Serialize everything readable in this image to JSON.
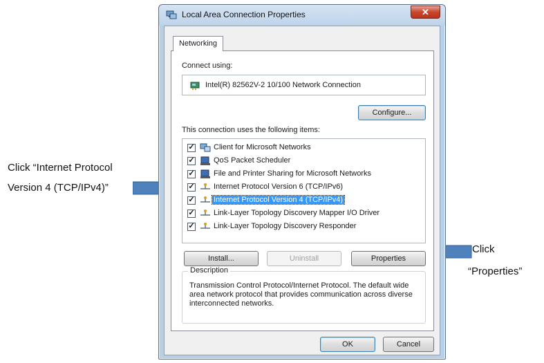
{
  "annotations": {
    "left_line1": "Click “Internet Protocol",
    "left_line2": "Version 4 (TCP/IPv4)”",
    "right_line1": "Click",
    "right_line2": "“Properties”"
  },
  "window": {
    "title": "Local Area Connection Properties",
    "close_glyph": "✕"
  },
  "tabs": [
    {
      "label": "Networking",
      "active": true
    }
  ],
  "connect_using": {
    "label": "Connect using:",
    "adapter": "Intel(R) 82562V-2 10/100 Network Connection",
    "icon": "network-adapter-icon"
  },
  "configure_label": "Configure...",
  "items_label": "This connection uses the following items:",
  "items": [
    {
      "label": "Client for Microsoft Networks",
      "checked": true,
      "icon": "client-network-icon"
    },
    {
      "label": "QoS Packet Scheduler",
      "checked": true,
      "icon": "service-icon"
    },
    {
      "label": "File and Printer Sharing for Microsoft Networks",
      "checked": true,
      "icon": "service-icon"
    },
    {
      "label": "Internet Protocol Version 6 (TCP/IPv6)",
      "checked": true,
      "icon": "protocol-icon"
    },
    {
      "label": "Internet Protocol Version 4 (TCP/IPv4)",
      "checked": true,
      "icon": "protocol-icon",
      "selected": true
    },
    {
      "label": "Link-Layer Topology Discovery Mapper I/O Driver",
      "checked": true,
      "icon": "protocol-icon"
    },
    {
      "label": "Link-Layer Topology Discovery Responder",
      "checked": true,
      "icon": "protocol-icon"
    }
  ],
  "buttons": {
    "install": "Install...",
    "uninstall": "Uninstall",
    "properties": "Properties",
    "ok": "OK",
    "cancel": "Cancel"
  },
  "description": {
    "title": "Description",
    "text": "Transmission Control Protocol/Internet Protocol. The default wide area network protocol that provides communication across diverse interconnected networks."
  },
  "colors": {
    "arrow_fill": "#4f81bd",
    "selection": "#3399ff"
  }
}
